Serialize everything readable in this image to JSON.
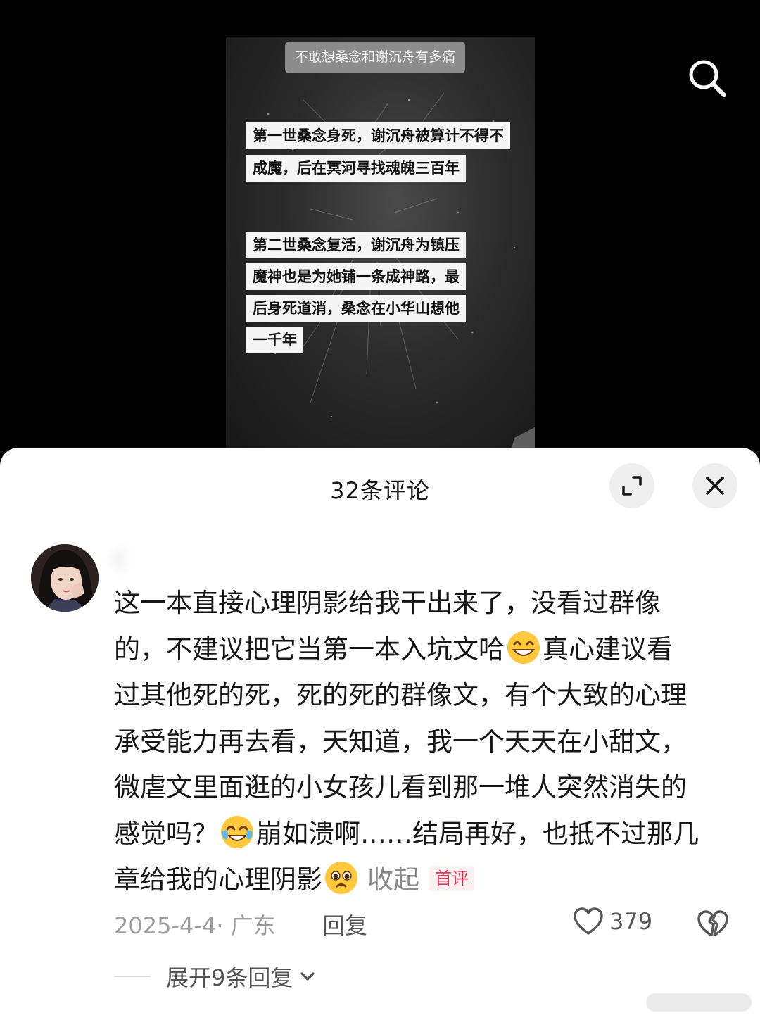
{
  "video": {
    "title": "不敢想桑念和谢沉舟有多痛",
    "captions": [
      "第一世桑念身死，谢沉舟被算计不得不",
      "成魔，后在冥河寻找魂魄三百年",
      "第二世桑念复活，谢沉舟为镇压",
      "魔神也是为她铺一条成神路，最",
      "后身死道消，桑念在小华山想他",
      "一千年"
    ]
  },
  "toolbar": {
    "search_icon": "search-icon"
  },
  "comments_sheet": {
    "title": "32条评论",
    "expand_icon": "expand-icon",
    "close_icon": "close-icon"
  },
  "comment": {
    "username": "C",
    "lines": [
      "这一本直接心理阴影给我干出来了，没看过群像",
      "的，不建议把它当第一本入坑文哈",
      "真心建议看",
      "过其他死的死，死的死的群像文，有个大致的心理",
      "承受能力再去看，天知道，我一个天天在小甜文，",
      "微虐文里面逛的小女孩儿看到那一堆人突然消失的",
      "感觉吗？",
      "崩如溃啊……结局再好，也抵不过那几",
      "章给我的心理阴影"
    ],
    "collapse_label": "收起",
    "first_badge": "首评",
    "date_location": "2025-4-4· 广东",
    "reply_label": "回复",
    "like_count": "379",
    "expand_replies_label": "展开9条回复",
    "emojis": [
      "grin-emoji",
      "tears-of-joy-emoji",
      "pleading-emoji"
    ]
  }
}
